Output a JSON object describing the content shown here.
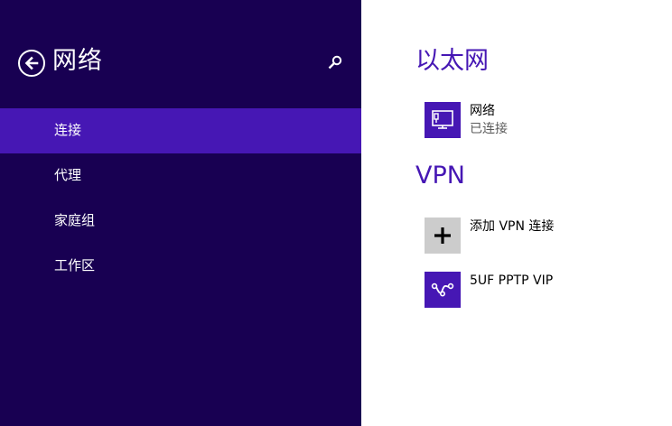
{
  "sidebar": {
    "title": "网络",
    "items": [
      {
        "label": "连接",
        "selected": true
      },
      {
        "label": "代理",
        "selected": false
      },
      {
        "label": "家庭组",
        "selected": false
      },
      {
        "label": "工作区",
        "selected": false
      }
    ]
  },
  "main": {
    "ethernet": {
      "title": "以太网",
      "connection": {
        "name": "网络",
        "status": "已连接",
        "icon": "ethernet-icon"
      }
    },
    "vpn": {
      "title": "VPN",
      "add": {
        "label": "添加 VPN 连接",
        "icon": "plus-icon"
      },
      "connection": {
        "name": "5UF PPTP VIP",
        "icon": "vpn-icon"
      }
    }
  },
  "colors": {
    "sidebar_bg": "#180052",
    "accent": "#4617b4",
    "main_bg": "#ffffff",
    "add_tile": "#cccccc"
  }
}
